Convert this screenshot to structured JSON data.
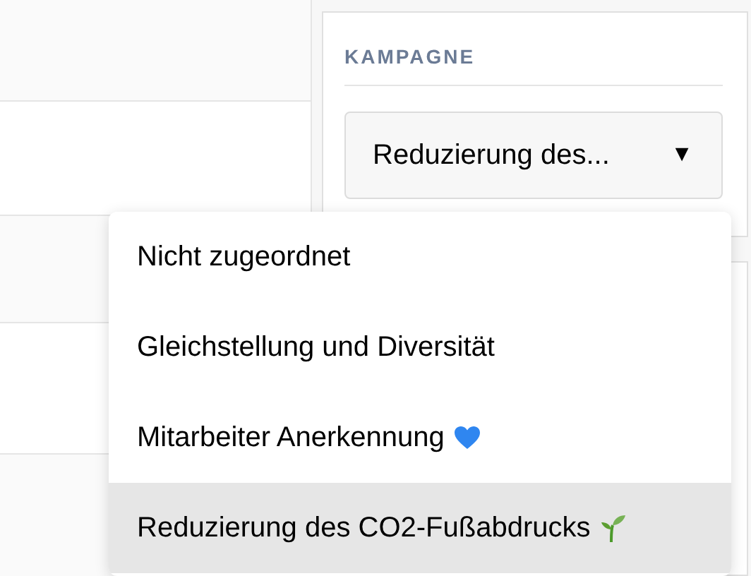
{
  "campaign_panel": {
    "label": "KAMPAGNE",
    "select": {
      "value": "Reduzierung des...",
      "arrow": "▼",
      "expanded": true
    },
    "options": [
      {
        "label": "Nicht zugeordnet",
        "kind": "plain",
        "selected": false
      },
      {
        "label": "Gleichstellung und Diversität",
        "kind": "plain",
        "selected": false
      },
      {
        "label": "Mitarbeiter Anerkennung",
        "kind": "heart",
        "selected": false
      },
      {
        "label": "Reduzierung des CO2-Fußabdrucks",
        "kind": "sprout",
        "selected": true
      }
    ]
  }
}
